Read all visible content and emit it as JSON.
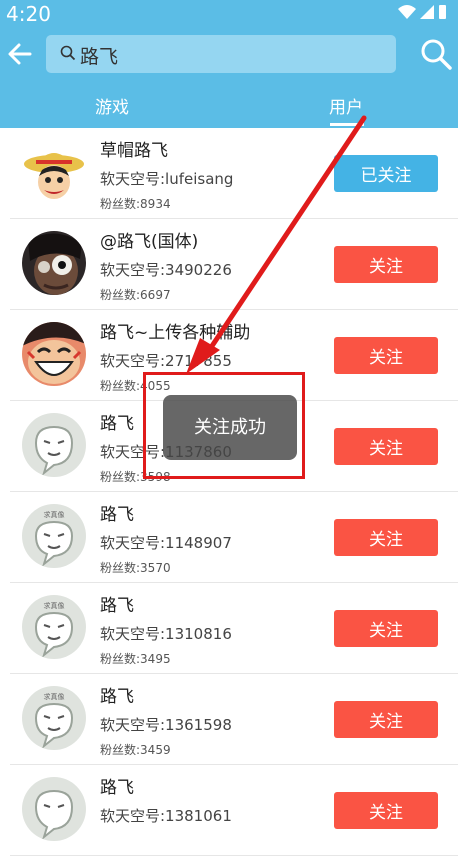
{
  "status": {
    "time": "4:20"
  },
  "search": {
    "query": "路飞"
  },
  "tabs": [
    {
      "label": "游戏"
    },
    {
      "label": "用户"
    }
  ],
  "users": [
    {
      "name": "草帽路飞",
      "id": "软天空号:lufeisang",
      "fans": "粉丝数:8934",
      "button": "已关注",
      "state": "followed",
      "avatar": "straw-hat-luffy"
    },
    {
      "name": "@路飞(国体)",
      "id": "软天空号:3490226",
      "fans": "粉丝数:6697",
      "button": "关注",
      "state": "follow",
      "avatar": "dark-face"
    },
    {
      "name": "路飞~上传各种辅助",
      "id": "软天空号:2717855",
      "fans": "粉丝数:4055",
      "button": "关注",
      "state": "follow",
      "avatar": "luffy-laugh"
    },
    {
      "name": "路飞",
      "id": "软天空号:1137860",
      "fans": "粉丝数:3598",
      "button": "关注",
      "state": "follow",
      "avatar": "default-mascot"
    },
    {
      "name": "路飞",
      "id": "软天空号:1148907",
      "fans": "粉丝数:3570",
      "button": "关注",
      "state": "follow",
      "avatar": "default-mascot"
    },
    {
      "name": "路飞",
      "id": "软天空号:1310816",
      "fans": "粉丝数:3495",
      "button": "关注",
      "state": "follow",
      "avatar": "default-mascot"
    },
    {
      "name": "路飞",
      "id": "软天空号:1361598",
      "fans": "粉丝数:3459",
      "button": "关注",
      "state": "follow",
      "avatar": "default-mascot"
    },
    {
      "name": "路飞",
      "id": "软天空号:1381061",
      "fans": "",
      "button": "关注",
      "state": "follow",
      "avatar": "default-mascot"
    }
  ],
  "mascot_label": "求真像",
  "toast": "关注成功",
  "colors": {
    "header": "#5bbde6",
    "follow": "#fa5444",
    "followed": "#44b3e5",
    "annotation": "#e01b1b"
  }
}
